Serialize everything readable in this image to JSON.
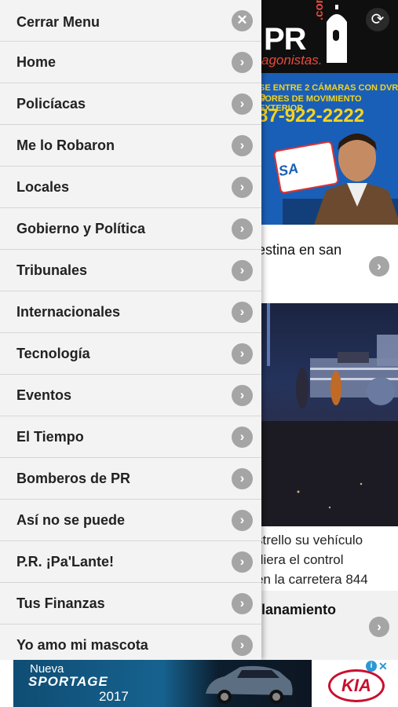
{
  "header": {
    "logo_text": "PR",
    "logo_com": ".com",
    "logo_sub": "agonistas.",
    "refresh_icon": "⟳"
  },
  "promo_banner": {
    "line1": "SE ENTRE 2 CÁMARAS CON DVR O",
    "line2": "SORES DE MOVIMIENTO EXTERIOR",
    "phone": "87-922-2222",
    "sign_text": "SA"
  },
  "articles": [
    {
      "title": "estina en san"
    },
    {
      "lines": [
        "strello su vehículo",
        "diera el control",
        "en la carretera 844"
      ]
    },
    {
      "title": "llanamiento"
    }
  ],
  "drawer": {
    "close_label": "Cerrar Menu",
    "items": [
      {
        "label": "Home"
      },
      {
        "label": "Policíacas"
      },
      {
        "label": "Me lo Robaron"
      },
      {
        "label": "Locales"
      },
      {
        "label": "Gobierno y Política"
      },
      {
        "label": "Tribunales"
      },
      {
        "label": "Internacionales"
      },
      {
        "label": "Tecnología"
      },
      {
        "label": "Eventos"
      },
      {
        "label": "El Tiempo"
      },
      {
        "label": "Bomberos de PR"
      },
      {
        "label": "Así no se puede"
      },
      {
        "label": "P.R. ¡Pa'Lante!"
      },
      {
        "label": "Tus Finanzas"
      },
      {
        "label": "Yo amo mi mascota"
      }
    ]
  },
  "icons": {
    "close": "✕",
    "chevron": "›"
  },
  "bottom_ad": {
    "nueva": "Nueva",
    "model": "SPORTAGE",
    "year": "2017",
    "brand": "KIA",
    "info": "i",
    "close": "✕"
  },
  "colors": {
    "drawer_bg": "#f3f3f3",
    "chevron_bg": "#a5a5a5",
    "logo_accent": "#e84a3c",
    "ad_blue": "#1a5fb7",
    "ad_yellow": "#f5d41e",
    "kia_red": "#c8102e"
  }
}
